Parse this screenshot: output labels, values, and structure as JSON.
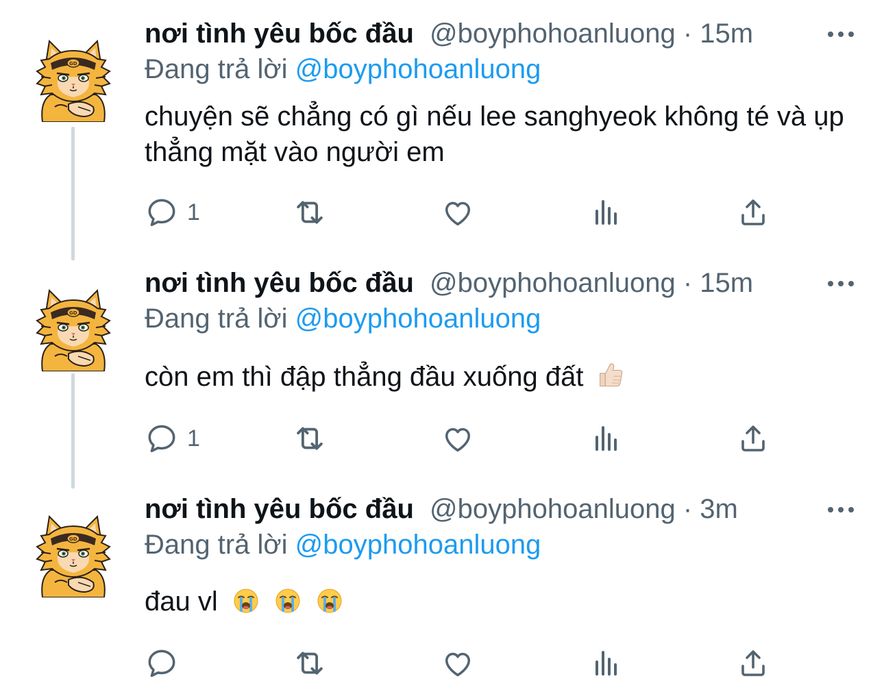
{
  "colors": {
    "text": "#0f1419",
    "secondary": "#536471",
    "mention": "#1d9bf0",
    "thread_line": "#cfd9de"
  },
  "tweets": [
    {
      "author_name": "nơi tình yêu bốc đầu",
      "handle": "@boyphohoanluong",
      "separator": "·",
      "time": "15m",
      "replying_prefix": "Đang trả lời",
      "replying_to": "@boyphohoanluong",
      "text": "chuyện sẽ chẳng có gì nếu lee sanghyeok không té và ụp thẳng mặt vào người em",
      "emoji": "",
      "reply_count": "1",
      "icons": [
        "reply-icon",
        "retweet-icon",
        "like-icon",
        "views-icon",
        "share-icon",
        "more-icon"
      ]
    },
    {
      "author_name": "nơi tình yêu bốc đầu",
      "handle": "@boyphohoanluong",
      "separator": "·",
      "time": "15m",
      "replying_prefix": "Đang trả lời",
      "replying_to": "@boyphohoanluong",
      "text": "còn em thì đập thẳng đầu xuống đất",
      "emoji": "thumbs-up-light-skin",
      "reply_count": "1",
      "icons": [
        "reply-icon",
        "retweet-icon",
        "like-icon",
        "views-icon",
        "share-icon",
        "more-icon"
      ]
    },
    {
      "author_name": "nơi tình yêu bốc đầu",
      "handle": "@boyphohoanluong",
      "separator": "·",
      "time": "3m",
      "replying_prefix": "Đang trả lời",
      "replying_to": "@boyphohoanluong",
      "text": "đau vl",
      "emoji": "loudly-crying-face x3",
      "reply_count": "",
      "icons": [
        "reply-icon",
        "retweet-icon",
        "like-icon",
        "views-icon",
        "share-icon",
        "more-icon"
      ]
    }
  ]
}
